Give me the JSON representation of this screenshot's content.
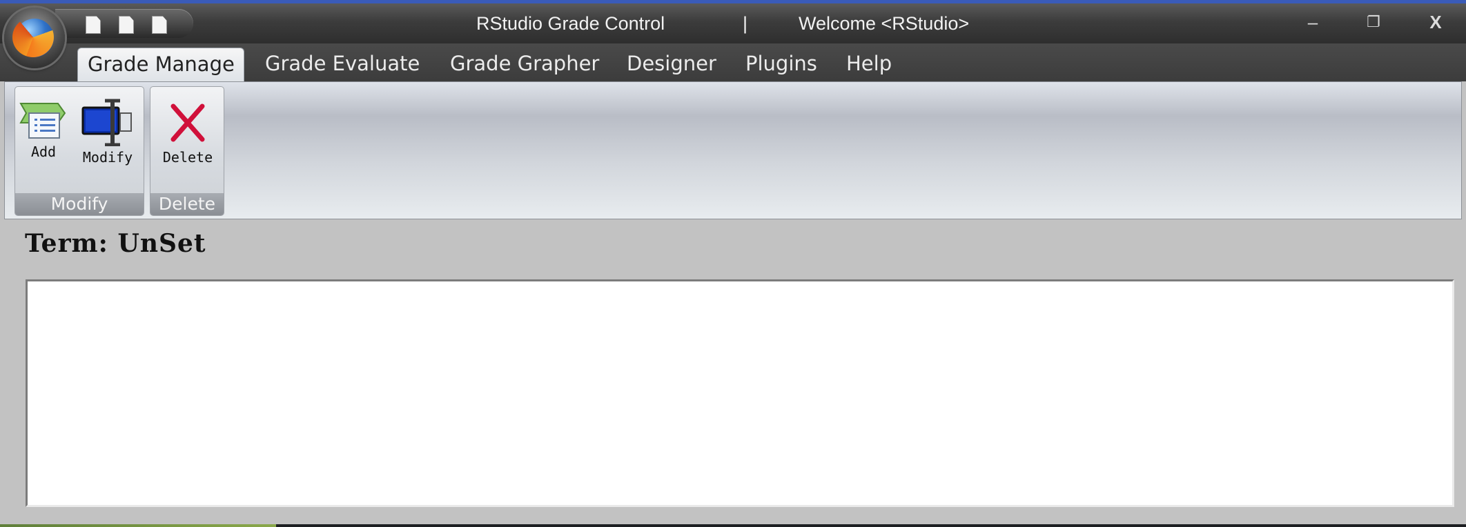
{
  "titlebar": {
    "app_name": "RStudio Grade Control",
    "separator": "|",
    "welcome": "Welcome <RStudio>",
    "minimize_symbol": "–",
    "restore_symbol": "❐",
    "close_symbol": "X"
  },
  "tabs": [
    {
      "label": "Grade Manage",
      "active": true
    },
    {
      "label": "Grade Evaluate",
      "active": false
    },
    {
      "label": "Grade Grapher",
      "active": false
    },
    {
      "label": "Designer",
      "active": false
    },
    {
      "label": "Plugins",
      "active": false
    },
    {
      "label": "Help",
      "active": false
    }
  ],
  "ribbon": {
    "groups": [
      {
        "name": "Modify",
        "buttons": [
          {
            "label": "Add",
            "icon": "add-list-icon"
          },
          {
            "label": "Modify",
            "icon": "modify-monitor-icon"
          }
        ]
      },
      {
        "name": "Delete",
        "buttons": [
          {
            "label": "Delete",
            "icon": "delete-x-icon"
          }
        ]
      }
    ]
  },
  "main": {
    "term_label": "Term: UnSet"
  },
  "colors": {
    "titlebar_border": "#3a5bb8",
    "delete_x": "#d0103a",
    "add_green": "#7cc05a",
    "modify_blue": "#0a2ea8"
  }
}
